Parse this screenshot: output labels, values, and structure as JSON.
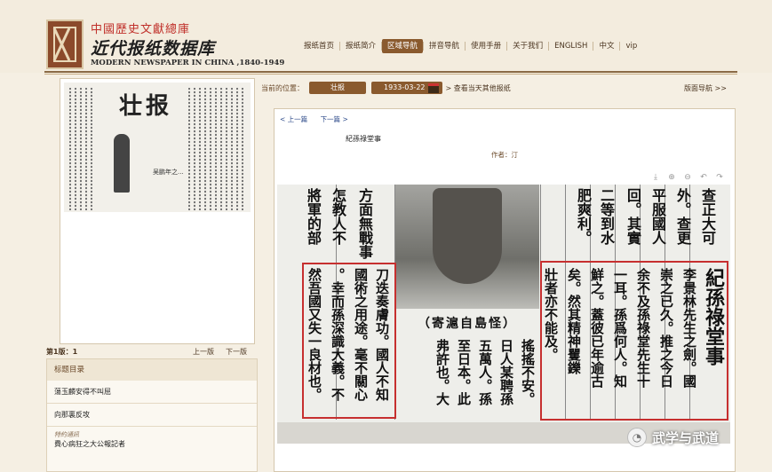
{
  "header": {
    "site_cn_small": "中國歷史文獻總庫",
    "site_cn_big": "近代报纸数据库",
    "site_en": "MODERN NEWSPAPER IN CHINA ,1840-1949"
  },
  "nav": {
    "items": [
      "报纸首页",
      "报纸简介",
      "区域导航",
      "拼音导航",
      "使用手册",
      "关于我们",
      "ENGLISH",
      "中文",
      "vip"
    ],
    "active_index": 2
  },
  "location": {
    "label": "当前的位置：",
    "paper": "壮报",
    "date": "1933-03-22",
    "other": "查看当天其他报纸",
    "layout_nav": "版面导航 >>"
  },
  "thumbnail": {
    "masthead": "壮报",
    "caption": "吴鹏年之..."
  },
  "pagebar": {
    "label": "第1版：1",
    "prev": "上一版",
    "next": "下一版"
  },
  "toc": {
    "header": "标题目录",
    "items": [
      {
        "title": "蕩玉麟安得不叫屈"
      },
      {
        "title": "向那裏反攻"
      },
      {
        "tag": "特約通訊",
        "title": "費心病狂之大公報記者"
      }
    ]
  },
  "article": {
    "prev": "< 上一篇",
    "next": "下一篇 >",
    "title": "紀孫祿堂事",
    "author_label": "作者：",
    "author": "汀",
    "caption": "（寄滬自島怪）",
    "colors": {
      "accent": "#8a5a2e",
      "highlight": "#c62f2f"
    }
  },
  "watermark": {
    "text": "武学与武道"
  }
}
